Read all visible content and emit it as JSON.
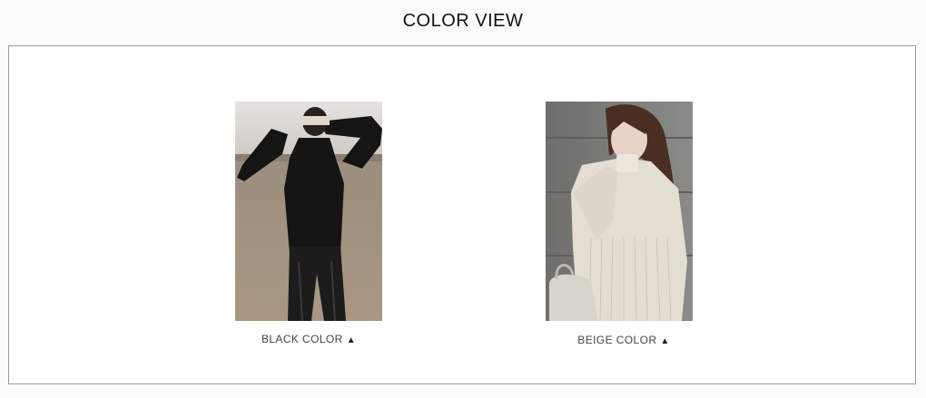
{
  "section": {
    "title": "COLOR VIEW"
  },
  "colors": [
    {
      "label": "BLACK COLOR",
      "arrow_icon": "triangle-up-icon"
    },
    {
      "label": "BEIGE COLOR",
      "arrow_icon": "triangle-up-icon"
    }
  ]
}
